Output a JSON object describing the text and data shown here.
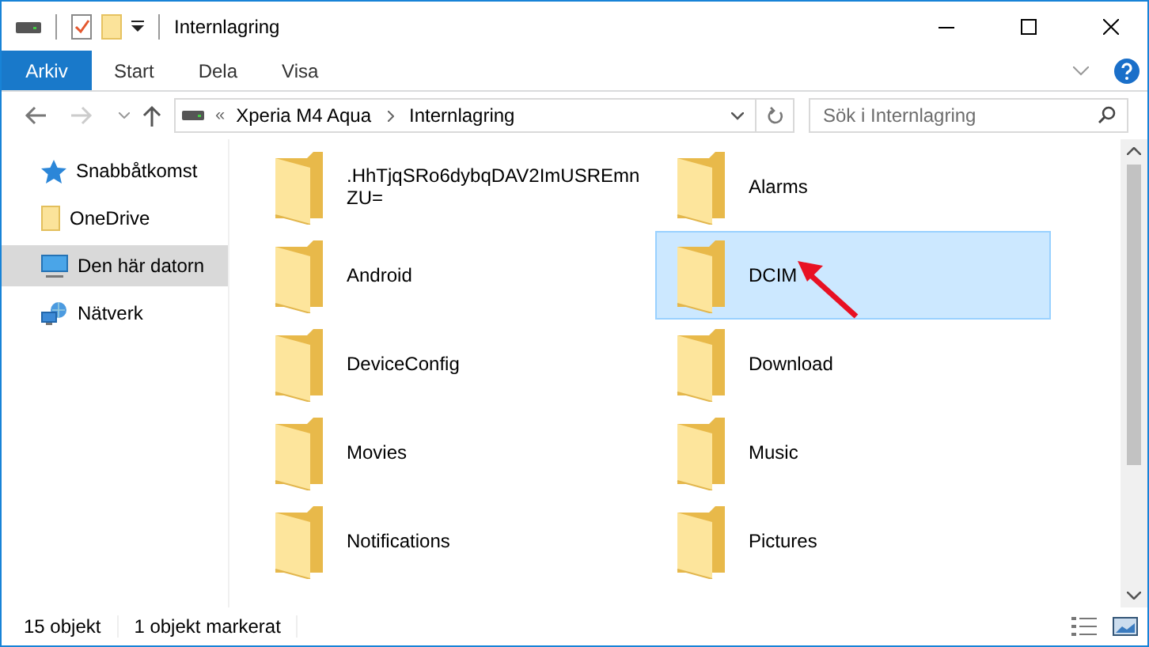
{
  "window": {
    "title": "Internlagring"
  },
  "ribbon_tabs": [
    {
      "label": "Arkiv",
      "selected": true
    },
    {
      "label": "Start",
      "selected": false
    },
    {
      "label": "Dela",
      "selected": false
    },
    {
      "label": "Visa",
      "selected": false
    }
  ],
  "address_bar": {
    "path": [
      {
        "label": "Xperia M4 Aqua"
      },
      {
        "label": "Internlagring"
      }
    ],
    "overflow": "«"
  },
  "search": {
    "placeholder": "Sök i Internlagring"
  },
  "sidebar": {
    "items": [
      {
        "label": "Snabbåtkomst",
        "kind": "star",
        "selected": false
      },
      {
        "label": "OneDrive",
        "kind": "folder",
        "selected": false
      },
      {
        "label": "Den här datorn",
        "kind": "computer",
        "selected": true
      },
      {
        "label": "Nätverk",
        "kind": "network",
        "selected": false
      }
    ]
  },
  "files": [
    {
      "name": ".HhTjqSRo6dybqDAV2ImUSREmnZU=",
      "selected": false
    },
    {
      "name": "Alarms",
      "selected": false
    },
    {
      "name": "Android",
      "selected": false
    },
    {
      "name": "DCIM",
      "selected": true
    },
    {
      "name": "DeviceConfig",
      "selected": false
    },
    {
      "name": "Download",
      "selected": false
    },
    {
      "name": "Movies",
      "selected": false
    },
    {
      "name": "Music",
      "selected": false
    },
    {
      "name": "Notifications",
      "selected": false
    },
    {
      "name": "Pictures",
      "selected": false
    }
  ],
  "status_bar": {
    "count": "15 objekt",
    "selection": "1 objekt markerat"
  }
}
